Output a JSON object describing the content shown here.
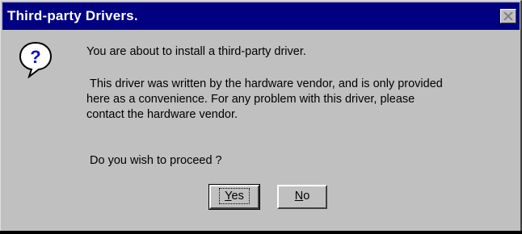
{
  "dialog": {
    "title": "Third-party Drivers.",
    "icon": "question-icon",
    "message": {
      "line1": "You are about to install a third-party driver.",
      "paragraph2": [
        " This driver was written by the hardware vendor, and is only provided",
        "here as a convenience.  For any problem with this driver, please",
        "contact the hardware vendor."
      ],
      "line3": "Do you wish to proceed ?"
    },
    "buttons": {
      "yes": {
        "mnemonic": "Y",
        "rest": "es"
      },
      "no": {
        "mnemonic": "N",
        "rest": "o"
      }
    }
  },
  "colors": {
    "titlebar": "#000080",
    "face": "#c0c0c0",
    "icon_blue": "#1010c0"
  }
}
